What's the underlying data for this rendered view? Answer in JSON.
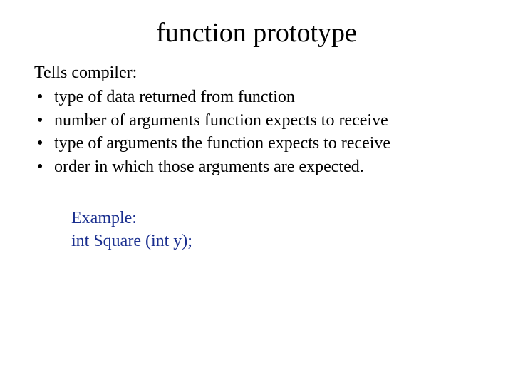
{
  "title": "function prototype",
  "intro": "Tells compiler:",
  "bullets": [
    "type of data returned from function",
    "number of arguments function expects to receive",
    "type of arguments the function expects to receive",
    "order in which those arguments are expected."
  ],
  "example": {
    "label": "Example:",
    "code": "int Square (int y);"
  }
}
